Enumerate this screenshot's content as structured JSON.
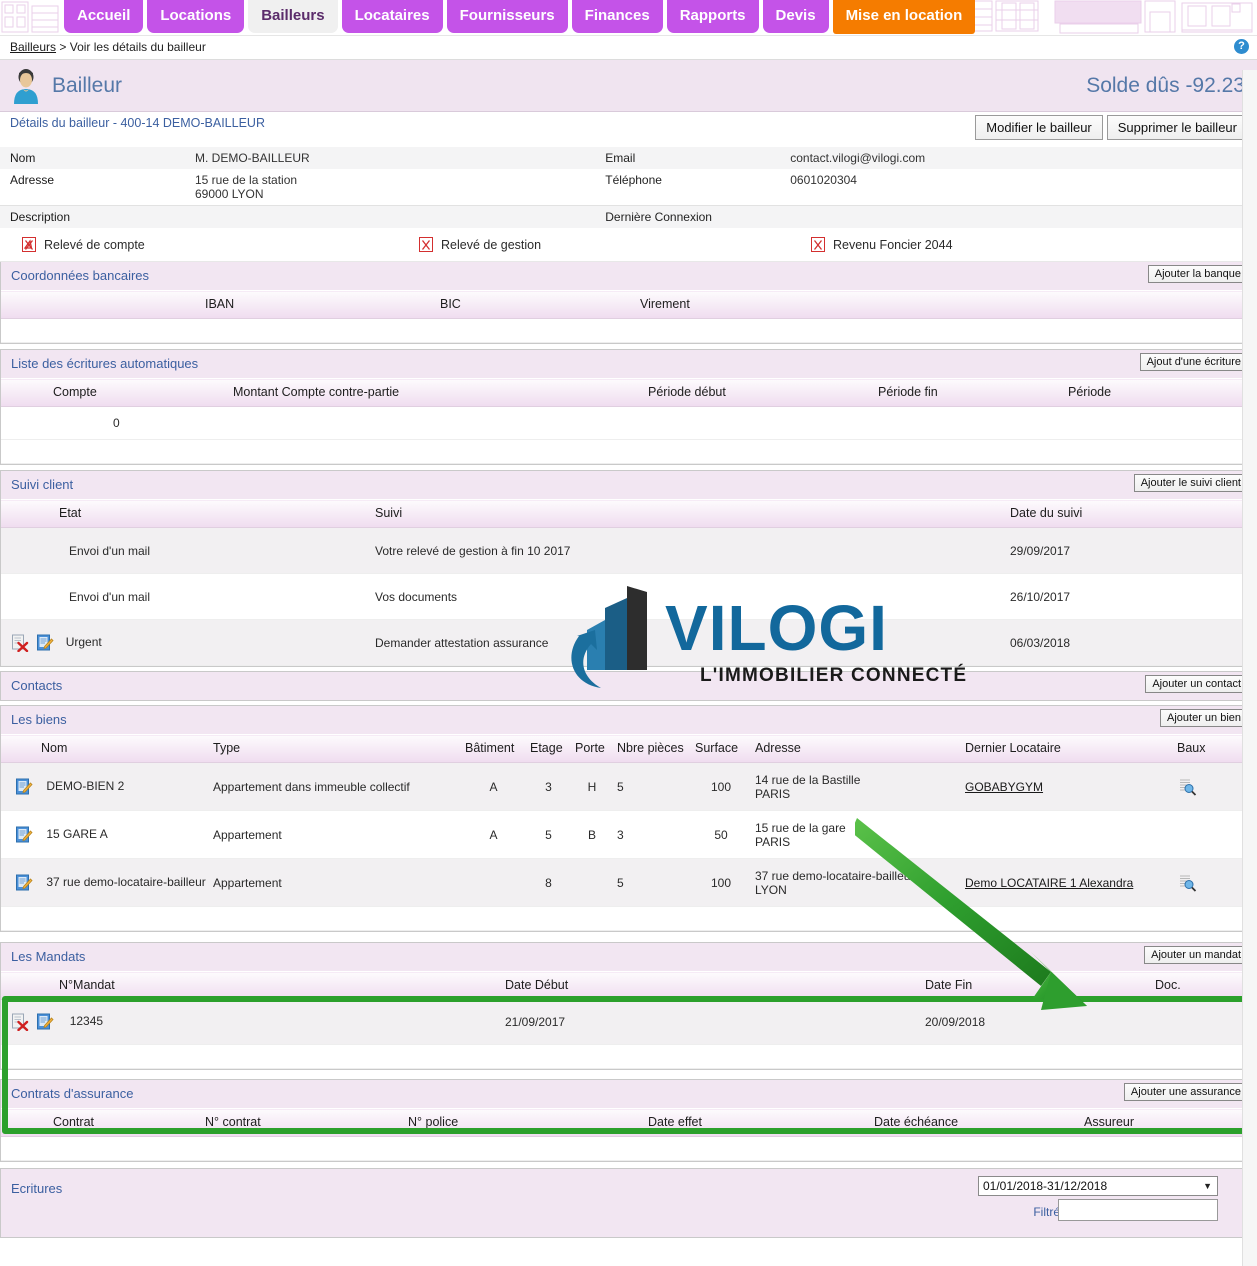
{
  "nav": {
    "tabs": [
      {
        "label": "Accueil",
        "state": "normal"
      },
      {
        "label": "Locations",
        "state": "normal"
      },
      {
        "label": "Bailleurs",
        "state": "active"
      },
      {
        "label": "Locataires",
        "state": "normal"
      },
      {
        "label": "Fournisseurs",
        "state": "normal"
      },
      {
        "label": "Finances",
        "state": "normal"
      },
      {
        "label": "Rapports",
        "state": "normal"
      },
      {
        "label": "Devis",
        "state": "normal"
      },
      {
        "label": "Mise en location",
        "state": "orange"
      }
    ]
  },
  "breadcrumb": {
    "root": "Bailleurs",
    "separator": ">",
    "current": "Voir les détails du bailleur"
  },
  "help_icon": "?",
  "header": {
    "title": "Bailleur",
    "balance": "Solde dûs -92.23"
  },
  "details": {
    "title": "Détails du bailleur - 400-14 DEMO-BAILLEUR",
    "edit_label": "Modifier le bailleur",
    "delete_label": "Supprimer le bailleur",
    "fields": [
      {
        "label": "Nom",
        "value": "M. DEMO-BAILLEUR",
        "label2": "Email",
        "value2": "contact.vilogi@vilogi.com"
      },
      {
        "label": "Adresse",
        "value": "15 rue de la station\n69000 LYON",
        "label2": "Téléphone",
        "value2": "0601020304"
      },
      {
        "label": "Description",
        "value": "",
        "label2": "Dernière Connexion",
        "value2": ""
      }
    ]
  },
  "pdf_links": [
    {
      "label": "Relevé de compte",
      "icon": "pdf-icon"
    },
    {
      "label": "Relevé de gestion",
      "icon": "pdf-icon"
    },
    {
      "label": "Revenu Foncier 2044",
      "icon": "pdf-icon"
    }
  ],
  "bank": {
    "title": "Coordonnées bancaires",
    "add_label": "Ajouter la banque",
    "columns": [
      "",
      "IBAN",
      "BIC",
      "Virement",
      ""
    ],
    "rows": []
  },
  "auto_entries": {
    "title": "Liste des écritures automatiques",
    "add_label": "Ajout d'une écriture",
    "columns": [
      "Compte",
      "Montant Compte contre-partie",
      "Période début",
      "Période fin",
      "Période"
    ],
    "rows": [
      {
        "compte": "0",
        "montant": "",
        "debut": "",
        "fin": "",
        "periode": ""
      }
    ]
  },
  "client_tracking": {
    "title": "Suivi client",
    "add_label": "Ajouter le suivi client",
    "columns": [
      "Etat",
      "Suivi",
      "Date du suivi"
    ],
    "rows": [
      {
        "icons": [],
        "etat": "Envoi d'un mail",
        "suivi": "Votre relevé de gestion à fin 10 2017",
        "date": "29/09/2017"
      },
      {
        "icons": [],
        "etat": "Envoi d'un mail",
        "suivi": "Vos documents",
        "date": "26/10/2017"
      },
      {
        "icons": [
          "delete-icon",
          "edit-icon"
        ],
        "etat": "Urgent",
        "suivi": "Demander attestation assurance",
        "date": "06/03/2018"
      }
    ]
  },
  "contacts": {
    "title": "Contacts",
    "add_label": "Ajouter un contact"
  },
  "properties": {
    "title": "Les biens",
    "add_label": "Ajouter un bien",
    "columns": [
      "Nom",
      "Type",
      "Bâtiment",
      "Etage",
      "Porte",
      "Nbre pièces",
      "Surface",
      "Adresse",
      "Dernier Locataire",
      "Baux"
    ],
    "rows": [
      {
        "icon": "edit-icon",
        "nom": "DEMO-BIEN 2",
        "type": "Appartement dans immeuble collectif",
        "batiment": "A",
        "etage": "3",
        "porte": "H",
        "pieces": "5",
        "surface": "100",
        "adresse": "14 rue de la Bastille\nPARIS",
        "locataire": "GOBABYGYM",
        "baux": "search-doc-icon"
      },
      {
        "icon": "edit-icon",
        "nom": "15 GARE A",
        "type": "Appartement",
        "batiment": "A",
        "etage": "5",
        "porte": "B",
        "pieces": "3",
        "surface": "50",
        "adresse": "15 rue de la gare\nPARIS",
        "locataire": "",
        "baux": ""
      },
      {
        "icon": "edit-icon",
        "nom": "37 rue demo-locataire-bailleur",
        "type": "Appartement",
        "batiment": "",
        "etage": "8",
        "porte": "",
        "pieces": "5",
        "surface": "100",
        "adresse": "37 rue demo-locataire-bailleur\nLYON",
        "locataire": "Demo LOCATAIRE 1 Alexandra",
        "baux": "search-doc-icon"
      }
    ]
  },
  "mandates": {
    "title": "Les Mandats",
    "add_label": "Ajouter un mandat",
    "columns": [
      "N°Mandat",
      "Date Début",
      "Date Fin",
      "Doc."
    ],
    "rows": [
      {
        "icons": [
          "delete-icon",
          "edit-icon"
        ],
        "numero": "12345",
        "debut": "21/09/2017",
        "fin": "20/09/2018",
        "doc": ""
      }
    ],
    "highlight_color": "#2ca02c"
  },
  "insurance": {
    "title": "Contrats d'assurance",
    "add_label": "Ajouter une assurance",
    "columns": [
      "Contrat",
      "N° contrat",
      "N° police",
      "Date effet",
      "Date échéance",
      "Assureur"
    ],
    "rows": []
  },
  "entries": {
    "title": "Ecritures",
    "period_value": "01/01/2018-31/12/2018",
    "filter_label": "Filtré",
    "filter_value": ""
  },
  "watermark": {
    "brand": "VILOGI",
    "tagline": "L'IMMOBILIER CONNECTÉ"
  }
}
